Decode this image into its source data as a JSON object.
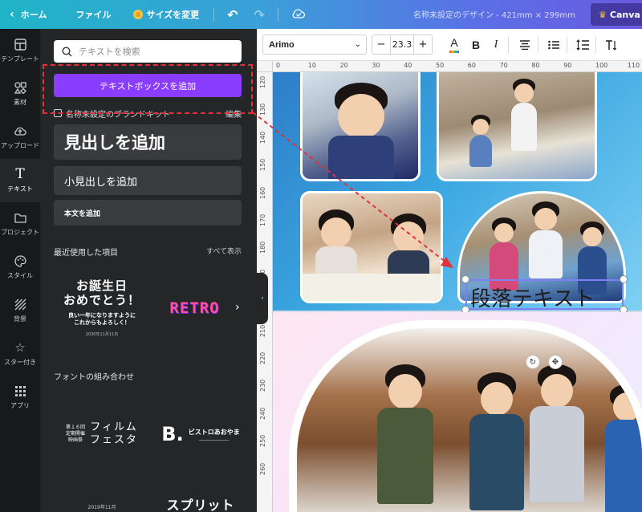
{
  "topbar": {
    "home": "ホーム",
    "file": "ファイル",
    "resize": "サイズを変更",
    "design_title": "名称未設定のデザイン - 421mm × 299mm",
    "pro_button": "Canva f"
  },
  "rail": {
    "items": [
      {
        "label": "テンプレート",
        "icon": "template-icon"
      },
      {
        "label": "素材",
        "icon": "elements-icon"
      },
      {
        "label": "アップロード",
        "icon": "upload-icon"
      },
      {
        "label": "テキスト",
        "icon": "text-icon"
      },
      {
        "label": "プロジェクト",
        "icon": "folder-icon"
      },
      {
        "label": "スタイル",
        "icon": "palette-icon"
      },
      {
        "label": "背景",
        "icon": "background-icon"
      },
      {
        "label": "スター付き",
        "icon": "star-icon"
      },
      {
        "label": "アプリ",
        "icon": "apps-icon"
      }
    ],
    "active": "テキスト"
  },
  "panel": {
    "search_placeholder": "テキストを検索",
    "add_textbox": "テキストボックスを追加",
    "brandkit_label": "名称未設定のブランドキット",
    "brandkit_edit": "編集",
    "heading": "見出しを追加",
    "subheading": "小見出しを追加",
    "body": "本文を追加",
    "recent_title": "最近使用した項目",
    "see_all": "すべて表示",
    "recent": {
      "bday_line1": "お誕生日",
      "bday_line2": "おめでとう！",
      "bday_sub1": "良い一年になりますように",
      "bday_sub2": "これからもよろしく！",
      "bday_date": "2030年11月11日",
      "retro": "RETRO"
    },
    "combo_title": "フォントの組み合わせ",
    "combos": {
      "film_small1": "第１６回",
      "film_small2": "定期開催",
      "film_small3": "映画祭",
      "film_big1": "フィルム",
      "film_big2": "フェスタ",
      "b_letter": "B.",
      "b_name": "ビストロあおやま",
      "year": "2019年11月",
      "split": "スプリット"
    }
  },
  "editor": {
    "font": "Arimo",
    "font_size": "23.3",
    "ruler_top": [
      "0",
      "10",
      "20",
      "30",
      "40",
      "50",
      "60",
      "70",
      "80",
      "90",
      "100",
      "110"
    ],
    "ruler_left": [
      "120",
      "130",
      "140",
      "150",
      "160",
      "170",
      "180",
      "190",
      "200",
      "210",
      "220",
      "230",
      "240",
      "250",
      "260"
    ],
    "paragraph_text": "段落テキスト"
  },
  "colors": {
    "accent": "#8b3dff",
    "annotation": "#e0323c",
    "selection": "#7f7ff2"
  }
}
